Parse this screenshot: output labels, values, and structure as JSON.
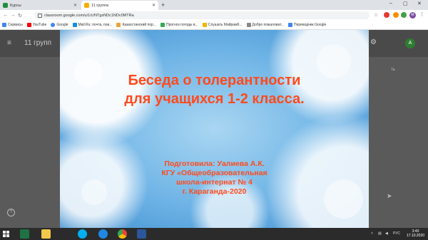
{
  "browser": {
    "tabs": [
      {
        "label": "Курсы",
        "active": false
      },
      {
        "label": "11 группа",
        "active": true
      }
    ],
    "url": "classroom.google.com/u/1/c/NTgxNDc1NDc0MTRa",
    "profile_initial": "M",
    "bookmarks": [
      {
        "label": "Сервисы",
        "icon": "apps-icon",
        "color": "#4285f4"
      },
      {
        "label": "YouTube",
        "icon": "youtube-icon",
        "color": "#ff0000"
      },
      {
        "label": "Google",
        "icon": "google-icon",
        "color": "#4285f4"
      },
      {
        "label": "Mail.Ru: почта, пои...",
        "icon": "mailru-icon",
        "color": "#168de2"
      },
      {
        "label": "Казахстанский пор...",
        "icon": "portal-icon",
        "color": "#e8a33d"
      },
      {
        "label": "Прогноз погоды в...",
        "icon": "weather-icon",
        "color": "#34a853"
      },
      {
        "label": "Слушать Майрамб...",
        "icon": "music-icon",
        "color": "#f4b400"
      },
      {
        "label": "Добро пожаловат...",
        "icon": "welcome-icon",
        "color": "#888888"
      },
      {
        "label": "Переводчик Google",
        "icon": "translate-icon",
        "color": "#4285f4"
      }
    ]
  },
  "classroom": {
    "menu_icon": "menu-icon",
    "title": "11 групп",
    "avatar_initial": "A",
    "side_text": "ть"
  },
  "slide": {
    "title_line1": "Беседа о толерантности",
    "title_line2": "для учащихся 1-2 класса.",
    "author_line1": "Подготовила: Уалиева А.К.",
    "author_line2": "КГУ «Общеобразовательная",
    "author_line3": "школа-интернат № 4",
    "author_line4": "г. Караганда-2020",
    "text_color": "#ff4a1c"
  },
  "taskbar": {
    "apps": [
      "excel-icon",
      "files-icon",
      "skype-icon",
      "ie-icon",
      "chrome-icon",
      "word-icon"
    ],
    "language": "РУС",
    "time": "3:40",
    "date": "17.10.2020"
  }
}
